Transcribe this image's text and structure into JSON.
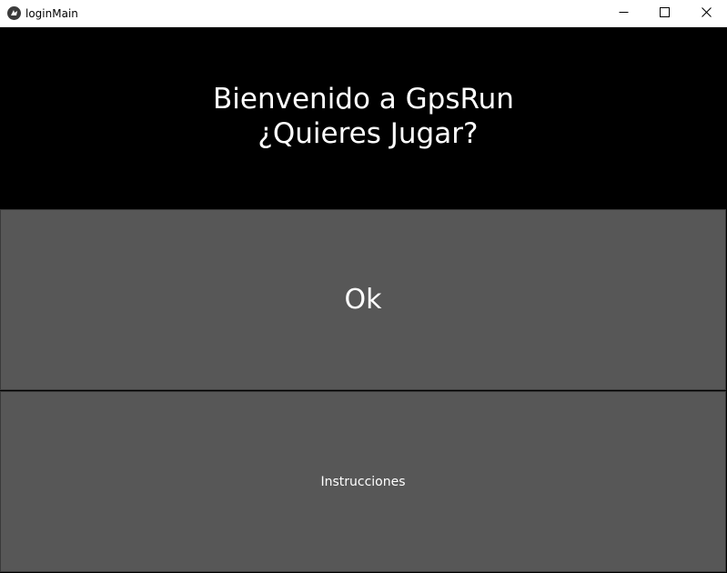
{
  "window": {
    "title": "loginMain",
    "app_icon": "kivy-logo-icon",
    "controls": [
      "minimize-icon",
      "maximize-icon",
      "close-icon"
    ]
  },
  "welcome": {
    "line1": "Bienvenido a GpsRun",
    "line2": " ¿Quieres Jugar?"
  },
  "buttons": {
    "ok_label": "Ok",
    "instructions_label": "Instrucciones"
  },
  "colors": {
    "background": "#000000",
    "button": "#575757",
    "text": "#ffffff",
    "titlebar": "#ffffff"
  }
}
